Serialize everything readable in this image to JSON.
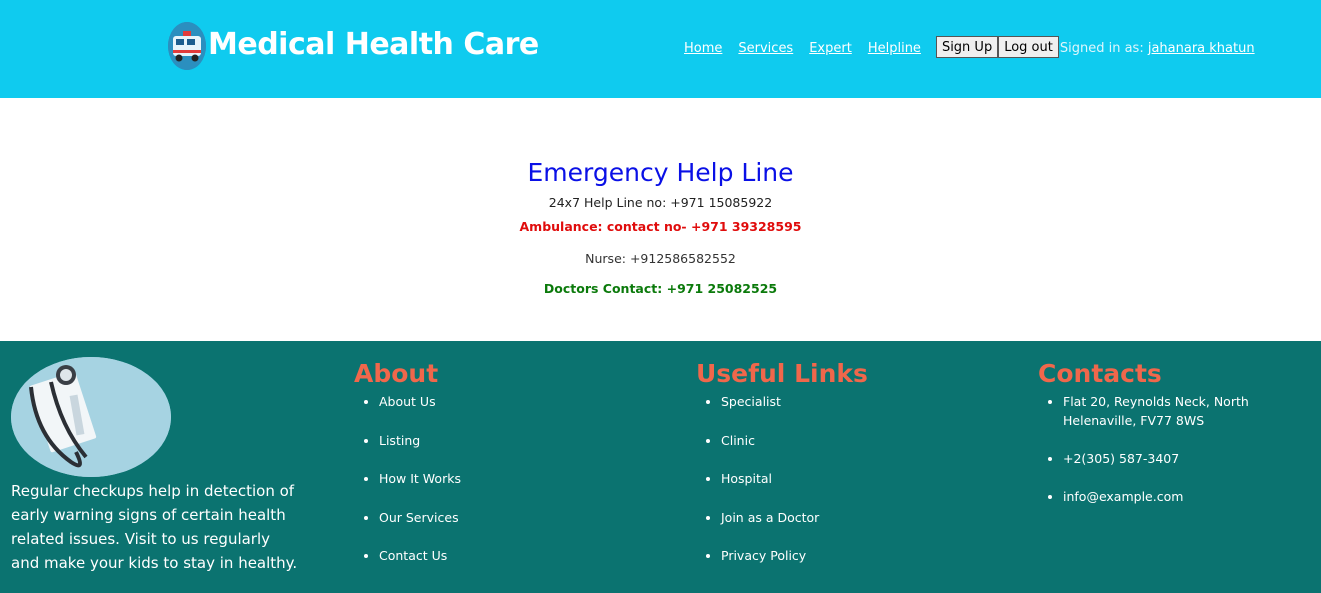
{
  "header": {
    "brand": "Medical Health Care",
    "nav": [
      "Home",
      "Services",
      "Expert",
      "Helpline"
    ],
    "signup_label": "Sign Up",
    "logout_label": "Log out",
    "signed_in_label": "Signed in as:",
    "user_name": "jahanara khatun"
  },
  "emergency": {
    "title": "Emergency Help Line",
    "helpline": "24x7 Help Line no: +971 15085922",
    "ambulance": "Ambulance: contact no- +971 39328595",
    "nurse": "Nurse: +912586582552",
    "doctors": "Doctors Contact: +971 25082525"
  },
  "footer": {
    "text": "Regular checkups help in detection of early warning signs of certain health related issues. Visit to us regularly and make your kids to stay in healthy.",
    "about": {
      "title": "About",
      "items": [
        "About Us",
        "Listing",
        "How It Works",
        "Our Services",
        "Contact Us"
      ]
    },
    "useful": {
      "title": "Useful Links",
      "items": [
        "Specialist",
        "Clinic",
        "Hospital",
        "Join as a Doctor",
        "Privacy Policy"
      ]
    },
    "contacts": {
      "title": "Contacts",
      "items": [
        "Flat 20, Reynolds Neck, North Helenaville, FV77 8WS",
        "+2(305) 587-3407",
        "info@example.com"
      ]
    }
  },
  "colors": {
    "header_bg": "#0fcbef",
    "footer_bg": "#0b7370",
    "heading_accent": "#f0674b",
    "title_blue": "#0a10e6",
    "ambulance_red": "#e00c0c",
    "doctor_green": "#0b7a0b"
  },
  "icons": {
    "logo": "ambulance-icon",
    "footer_image": "stethoscope-image"
  }
}
